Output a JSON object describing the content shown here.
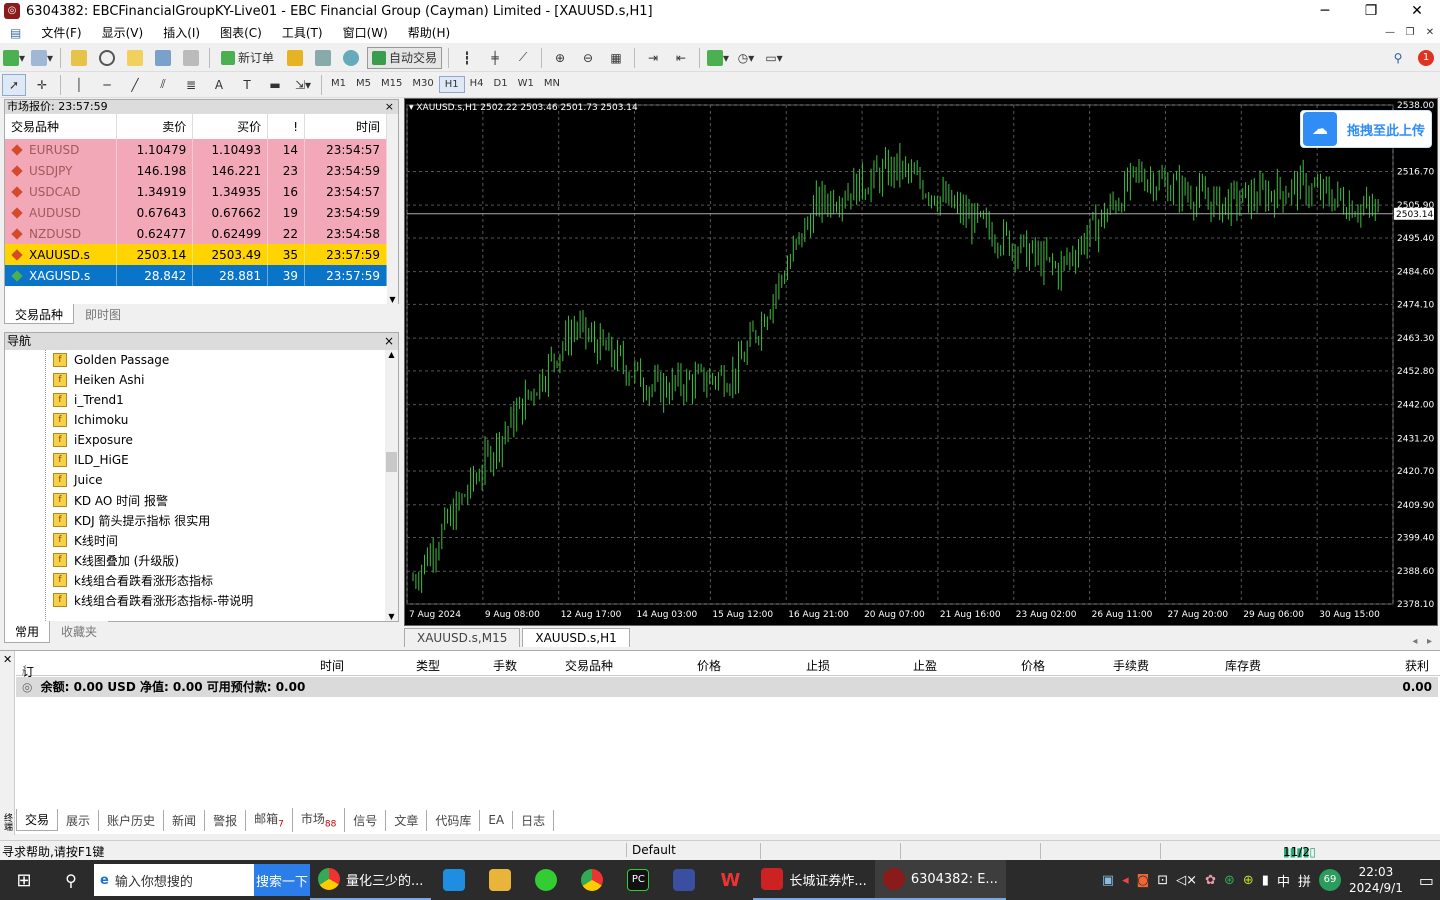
{
  "window": {
    "title": "6304382: EBCFinancialGroupKY-Live01 - EBC Financial Group (Cayman) Limited - [XAUUSD.s,H1]",
    "minimize": "─",
    "restore": "❐",
    "close": "✕"
  },
  "menu": [
    "文件(F)",
    "显示(V)",
    "插入(I)",
    "图表(C)",
    "工具(T)",
    "窗口(W)",
    "帮助(H)"
  ],
  "toolbar": {
    "new_order": "新订单",
    "auto_trade": "自动交易",
    "notif_count": "1"
  },
  "timeframes": [
    "M1",
    "M5",
    "M15",
    "M30",
    "H1",
    "H4",
    "D1",
    "W1",
    "MN"
  ],
  "active_tf": "H1",
  "market_watch": {
    "title": "市场报价: 23:57:59",
    "cols": [
      "交易品种",
      "卖价",
      "买价",
      "!",
      "时间"
    ],
    "rows": [
      {
        "sym": "EURUSD",
        "bid": "1.10479",
        "ask": "1.10493",
        "spread": "14",
        "time": "23:54:57",
        "style": "pink"
      },
      {
        "sym": "USDJPY",
        "bid": "146.198",
        "ask": "146.221",
        "spread": "23",
        "time": "23:54:59",
        "style": "pink"
      },
      {
        "sym": "USDCAD",
        "bid": "1.34919",
        "ask": "1.34935",
        "spread": "16",
        "time": "23:54:57",
        "style": "pink"
      },
      {
        "sym": "AUDUSD",
        "bid": "0.67643",
        "ask": "0.67662",
        "spread": "19",
        "time": "23:54:59",
        "style": "pink"
      },
      {
        "sym": "NZDUSD",
        "bid": "0.62477",
        "ask": "0.62499",
        "spread": "22",
        "time": "23:54:58",
        "style": "pink"
      },
      {
        "sym": "XAUUSD.s",
        "bid": "2503.14",
        "ask": "2503.49",
        "spread": "35",
        "time": "23:57:59",
        "style": "yel"
      },
      {
        "sym": "XAGUSD.s",
        "bid": "28.842",
        "ask": "28.881",
        "spread": "39",
        "time": "23:57:59",
        "style": "blu"
      }
    ],
    "tabs": [
      "交易品种",
      "即时图"
    ]
  },
  "navigator": {
    "title": "导航",
    "items": [
      "Golden Passage",
      "Heiken Ashi",
      "i_Trend1",
      "Ichimoku",
      "iExposure",
      "ILD_HiGE",
      "Juice",
      "KD AO 时间 报警",
      "KDJ 箭头提示指标 很实用",
      "K线时间",
      "K线图叠加 (升级版)",
      "k线组合看跌看涨形态指标",
      "k线组合看跌看涨形态指标-带说明"
    ],
    "tabs": [
      "常用",
      "收藏夹"
    ]
  },
  "chart": {
    "info": "XAUUSD.s,H1  2502.22 2503.46 2501.73 2503.14",
    "price_labels": [
      "2538.00",
      "2516.70",
      "2505.90",
      "2495.40",
      "2484.60",
      "2474.10",
      "2463.30",
      "2452.80",
      "2442.00",
      "2431.20",
      "2420.70",
      "2409.90",
      "2399.40",
      "2388.60",
      "2378.10"
    ],
    "current_price": "2503.14",
    "time_labels": [
      "7 Aug 2024",
      "9 Aug 08:00",
      "12 Aug 17:00",
      "14 Aug 03:00",
      "15 Aug 12:00",
      "16 Aug 21:00",
      "20 Aug 07:00",
      "21 Aug 16:00",
      "23 Aug 02:00",
      "26 Aug 11:00",
      "27 Aug 20:00",
      "29 Aug 06:00",
      "30 Aug 15:00"
    ],
    "tabs": [
      "XAUUSD.s,M15",
      "XAUUSD.s,H1"
    ],
    "upload_label": "拖拽至此上传",
    "candle_color": "#3fbf3f"
  },
  "chart_data": {
    "type": "line",
    "title": "XAUUSD.s,H1",
    "ylim": [
      2378.1,
      2538.0
    ],
    "x": [
      "7 Aug 2024",
      "9 Aug 08:00",
      "12 Aug 17:00",
      "14 Aug 03:00",
      "15 Aug 12:00",
      "16 Aug 21:00",
      "20 Aug 07:00",
      "21 Aug 16:00",
      "23 Aug 02:00",
      "26 Aug 11:00",
      "27 Aug 20:00",
      "29 Aug 06:00",
      "30 Aug 15:00"
    ],
    "series": [
      {
        "values": [
          2386,
          2428,
          2467,
          2447,
          2452,
          2506,
          2518,
          2500,
          2485,
          2516,
          2506,
          2512,
          2503
        ]
      }
    ]
  },
  "terminal": {
    "cols": [
      "订单",
      "时间",
      "类型",
      "手数",
      "交易品种",
      "价格",
      "止损",
      "止盈",
      "价格",
      "手续费",
      "库存费",
      "获利"
    ],
    "balance": "余额: 0.00 USD  净值: 0.00  可用预付款: 0.00",
    "profit": "0.00",
    "tabs": [
      {
        "label": "交易",
        "badge": ""
      },
      {
        "label": "展示",
        "badge": ""
      },
      {
        "label": "账户历史",
        "badge": ""
      },
      {
        "label": "新闻",
        "badge": ""
      },
      {
        "label": "警报",
        "badge": ""
      },
      {
        "label": "邮箱",
        "badge": "7"
      },
      {
        "label": "市场",
        "badge": "88"
      },
      {
        "label": "信号",
        "badge": ""
      },
      {
        "label": "文章",
        "badge": ""
      },
      {
        "label": "代码库",
        "badge": ""
      },
      {
        "label": "EA",
        "badge": ""
      },
      {
        "label": "日志",
        "badge": ""
      }
    ],
    "side_label": "终端"
  },
  "status": {
    "help": "寻求帮助,请按F1键",
    "profile": "Default",
    "traffic": "11/2 kb"
  },
  "taskbar": {
    "search_placeholder": "输入你想搜的",
    "search_btn": "搜索一下",
    "app1": "量化三少的...",
    "app2": "长城证券炸...",
    "app3": "6304382: E...",
    "ime": "中",
    "ime2": "拼",
    "battery": "69",
    "time": "22:03",
    "date": "2024/9/1"
  }
}
